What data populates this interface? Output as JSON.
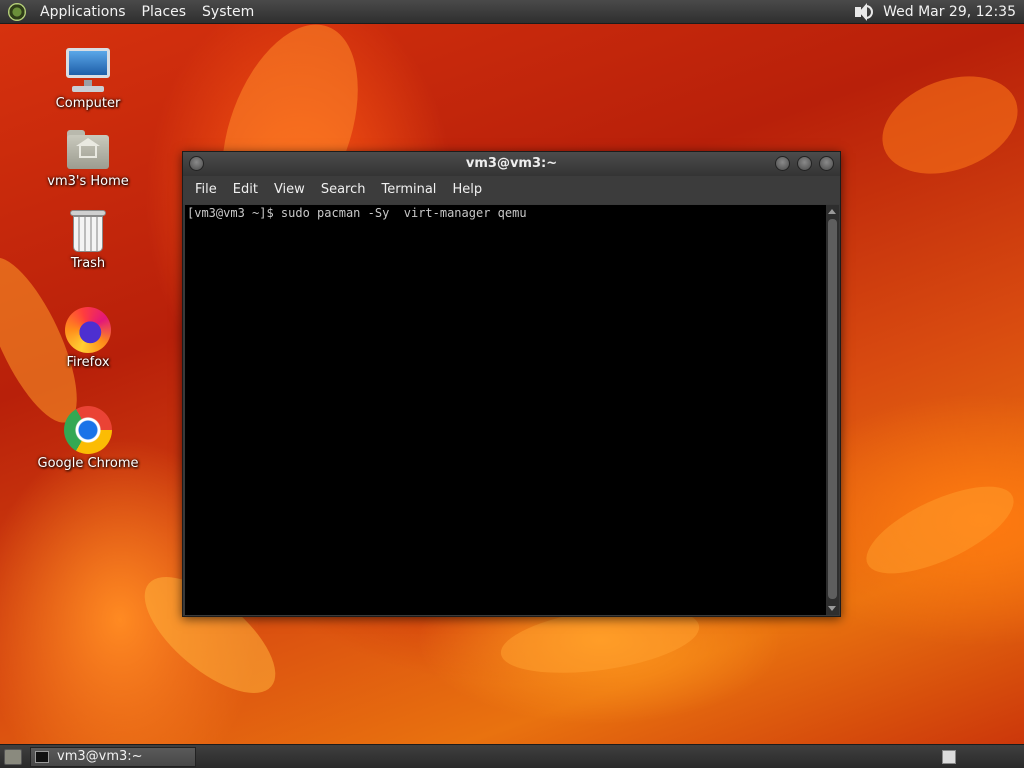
{
  "top_panel": {
    "menus": [
      "Applications",
      "Places",
      "System"
    ],
    "clock": "Wed Mar 29, 12:35",
    "icons": {
      "logo": "distro-logo-icon",
      "volume": "volume-icon"
    }
  },
  "desktop_icons": [
    {
      "label": "Computer",
      "icon": "computer-icon"
    },
    {
      "label": "vm3's Home",
      "icon": "home-folder-icon"
    },
    {
      "label": "Trash",
      "icon": "trash-icon"
    },
    {
      "label": "Firefox",
      "icon": "firefox-icon"
    },
    {
      "label": "Google Chrome",
      "icon": "chrome-icon"
    }
  ],
  "terminal": {
    "title": "vm3@vm3:~",
    "menu": [
      "File",
      "Edit",
      "View",
      "Search",
      "Terminal",
      "Help"
    ],
    "lines": [
      "[vm3@vm3 ~]$ sudo pacman -Sy  virt-manager qemu"
    ]
  },
  "taskbar": {
    "window_label": "vm3@vm3:~"
  },
  "colors": {
    "panel_bg": "#3a3a3a",
    "terminal_bg": "#000000",
    "terminal_fg": "#c8c8c8"
  }
}
